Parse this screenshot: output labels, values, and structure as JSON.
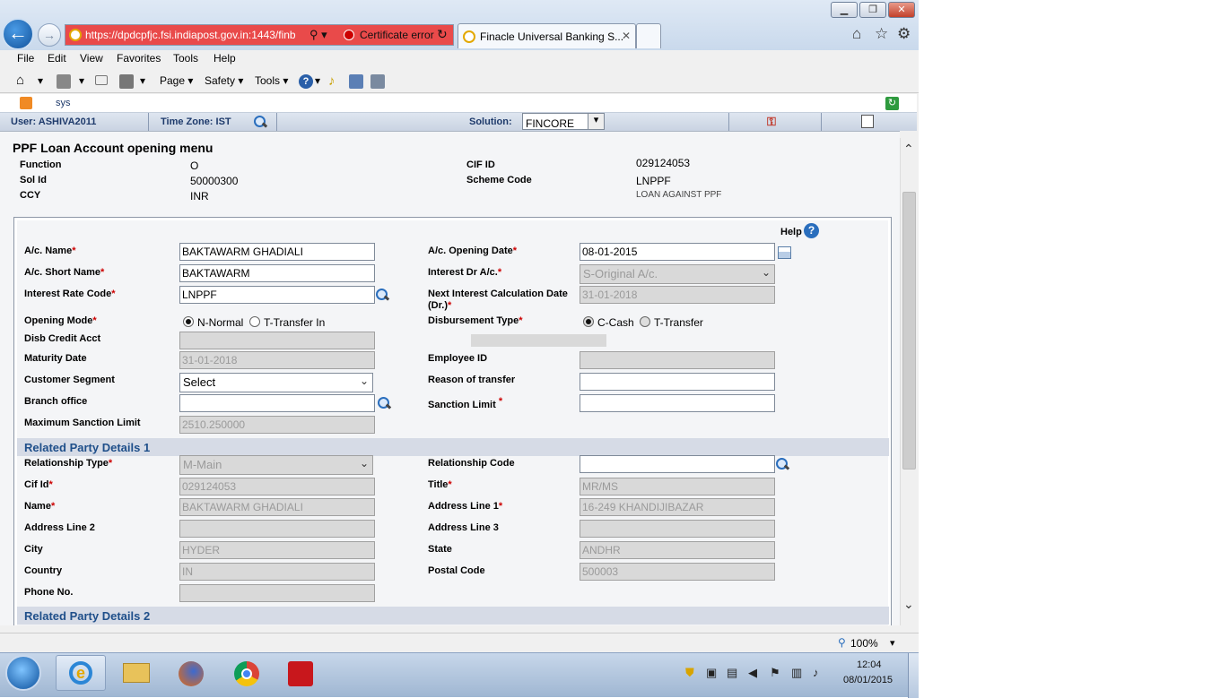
{
  "browser": {
    "url": "https://dpdcpfjc.fsi.indiapost.gov.in:1443/finb",
    "cert_error": "Certificate error",
    "tab_title": "Finacle Universal Banking S...",
    "menu": [
      "File",
      "Edit",
      "View",
      "Favorites",
      "Tools",
      "Help"
    ],
    "commands": {
      "page": "Page",
      "safety": "Safety",
      "tools": "Tools"
    },
    "zoom": "100%"
  },
  "app": {
    "top_label": "sys",
    "user": "User: ASHIVA2011",
    "timezone": "Time Zone:  IST",
    "solution_label": "Solution:",
    "solution_value": "FINCORE"
  },
  "page": {
    "title": "PPF Loan Account opening menu",
    "header": {
      "function_label": "Function",
      "function_value": "O",
      "solid_label": "Sol Id",
      "solid_value": "50000300",
      "ccy_label": "CCY",
      "ccy_value": "INR",
      "cifid_label": "CIF ID",
      "cifid_value": "029124053",
      "scheme_label": "Scheme Code",
      "scheme_value": "LNPPF",
      "scheme_desc": "LOAN AGAINST PPF"
    },
    "help": "Help",
    "fields": {
      "ac_name": {
        "label": "A/c. Name",
        "value": "BAKTAWARM GHADIALI"
      },
      "ac_short": {
        "label": "A/c. Short Name",
        "value": "BAKTAWARM"
      },
      "int_rate": {
        "label": "Interest Rate Code",
        "value": "LNPPF"
      },
      "open_mode": {
        "label": "Opening Mode",
        "opt1": "N-Normal",
        "opt2": "T-Transfer In"
      },
      "disb_credit": {
        "label": "Disb Credit Acct",
        "value": ""
      },
      "maturity": {
        "label": "Maturity Date",
        "value": "31-01-2018"
      },
      "cust_seg": {
        "label": "Customer Segment",
        "value": "Select"
      },
      "branch": {
        "label": "Branch office",
        "value": ""
      },
      "max_sanction": {
        "label": "Maximum Sanction Limit",
        "value": "2510.250000"
      },
      "open_date": {
        "label": "A/c. Opening Date",
        "value": "08-01-2015"
      },
      "int_dr": {
        "label": "Interest Dr A/c.",
        "value": "S-Original A/c."
      },
      "next_int": {
        "label": "Next Interest Calculation Date",
        "label2": "(Dr.)",
        "value": "31-01-2018"
      },
      "disb_type": {
        "label": "Disbursement Type",
        "opt1": "C-Cash",
        "opt2": "T-Transfer"
      },
      "employee": {
        "label": "Employee ID",
        "value": ""
      },
      "reason": {
        "label": "Reason of transfer",
        "value": ""
      },
      "sanction": {
        "label": "Sanction Limit",
        "value": ""
      }
    },
    "rp1": {
      "title": "Related Party Details 1",
      "rel_type": {
        "label": "Relationship Type",
        "value": "M-Main"
      },
      "cif": {
        "label": "Cif Id",
        "value": "029124053"
      },
      "name": {
        "label": "Name",
        "value": "BAKTAWARM GHADIALI"
      },
      "addr2": {
        "label": "Address Line 2",
        "value": ""
      },
      "city": {
        "label": "City",
        "value": "HYDER"
      },
      "country": {
        "label": "Country",
        "value": "IN"
      },
      "phone": {
        "label": "Phone No.",
        "value": ""
      },
      "rel_code": {
        "label": "Relationship Code",
        "value": ""
      },
      "title_f": {
        "label": "Title",
        "value": "MR/MS"
      },
      "addr1": {
        "label": "Address Line 1",
        "value": "16-249 KHANDIJIBAZAR"
      },
      "addr3": {
        "label": "Address Line 3",
        "value": ""
      },
      "state": {
        "label": "State",
        "value": "ANDHR"
      },
      "postal": {
        "label": "Postal Code",
        "value": "500003"
      }
    },
    "rp2_title": "Related Party Details 2"
  },
  "taskbar": {
    "time": "12:04",
    "date": "08/01/2015"
  }
}
